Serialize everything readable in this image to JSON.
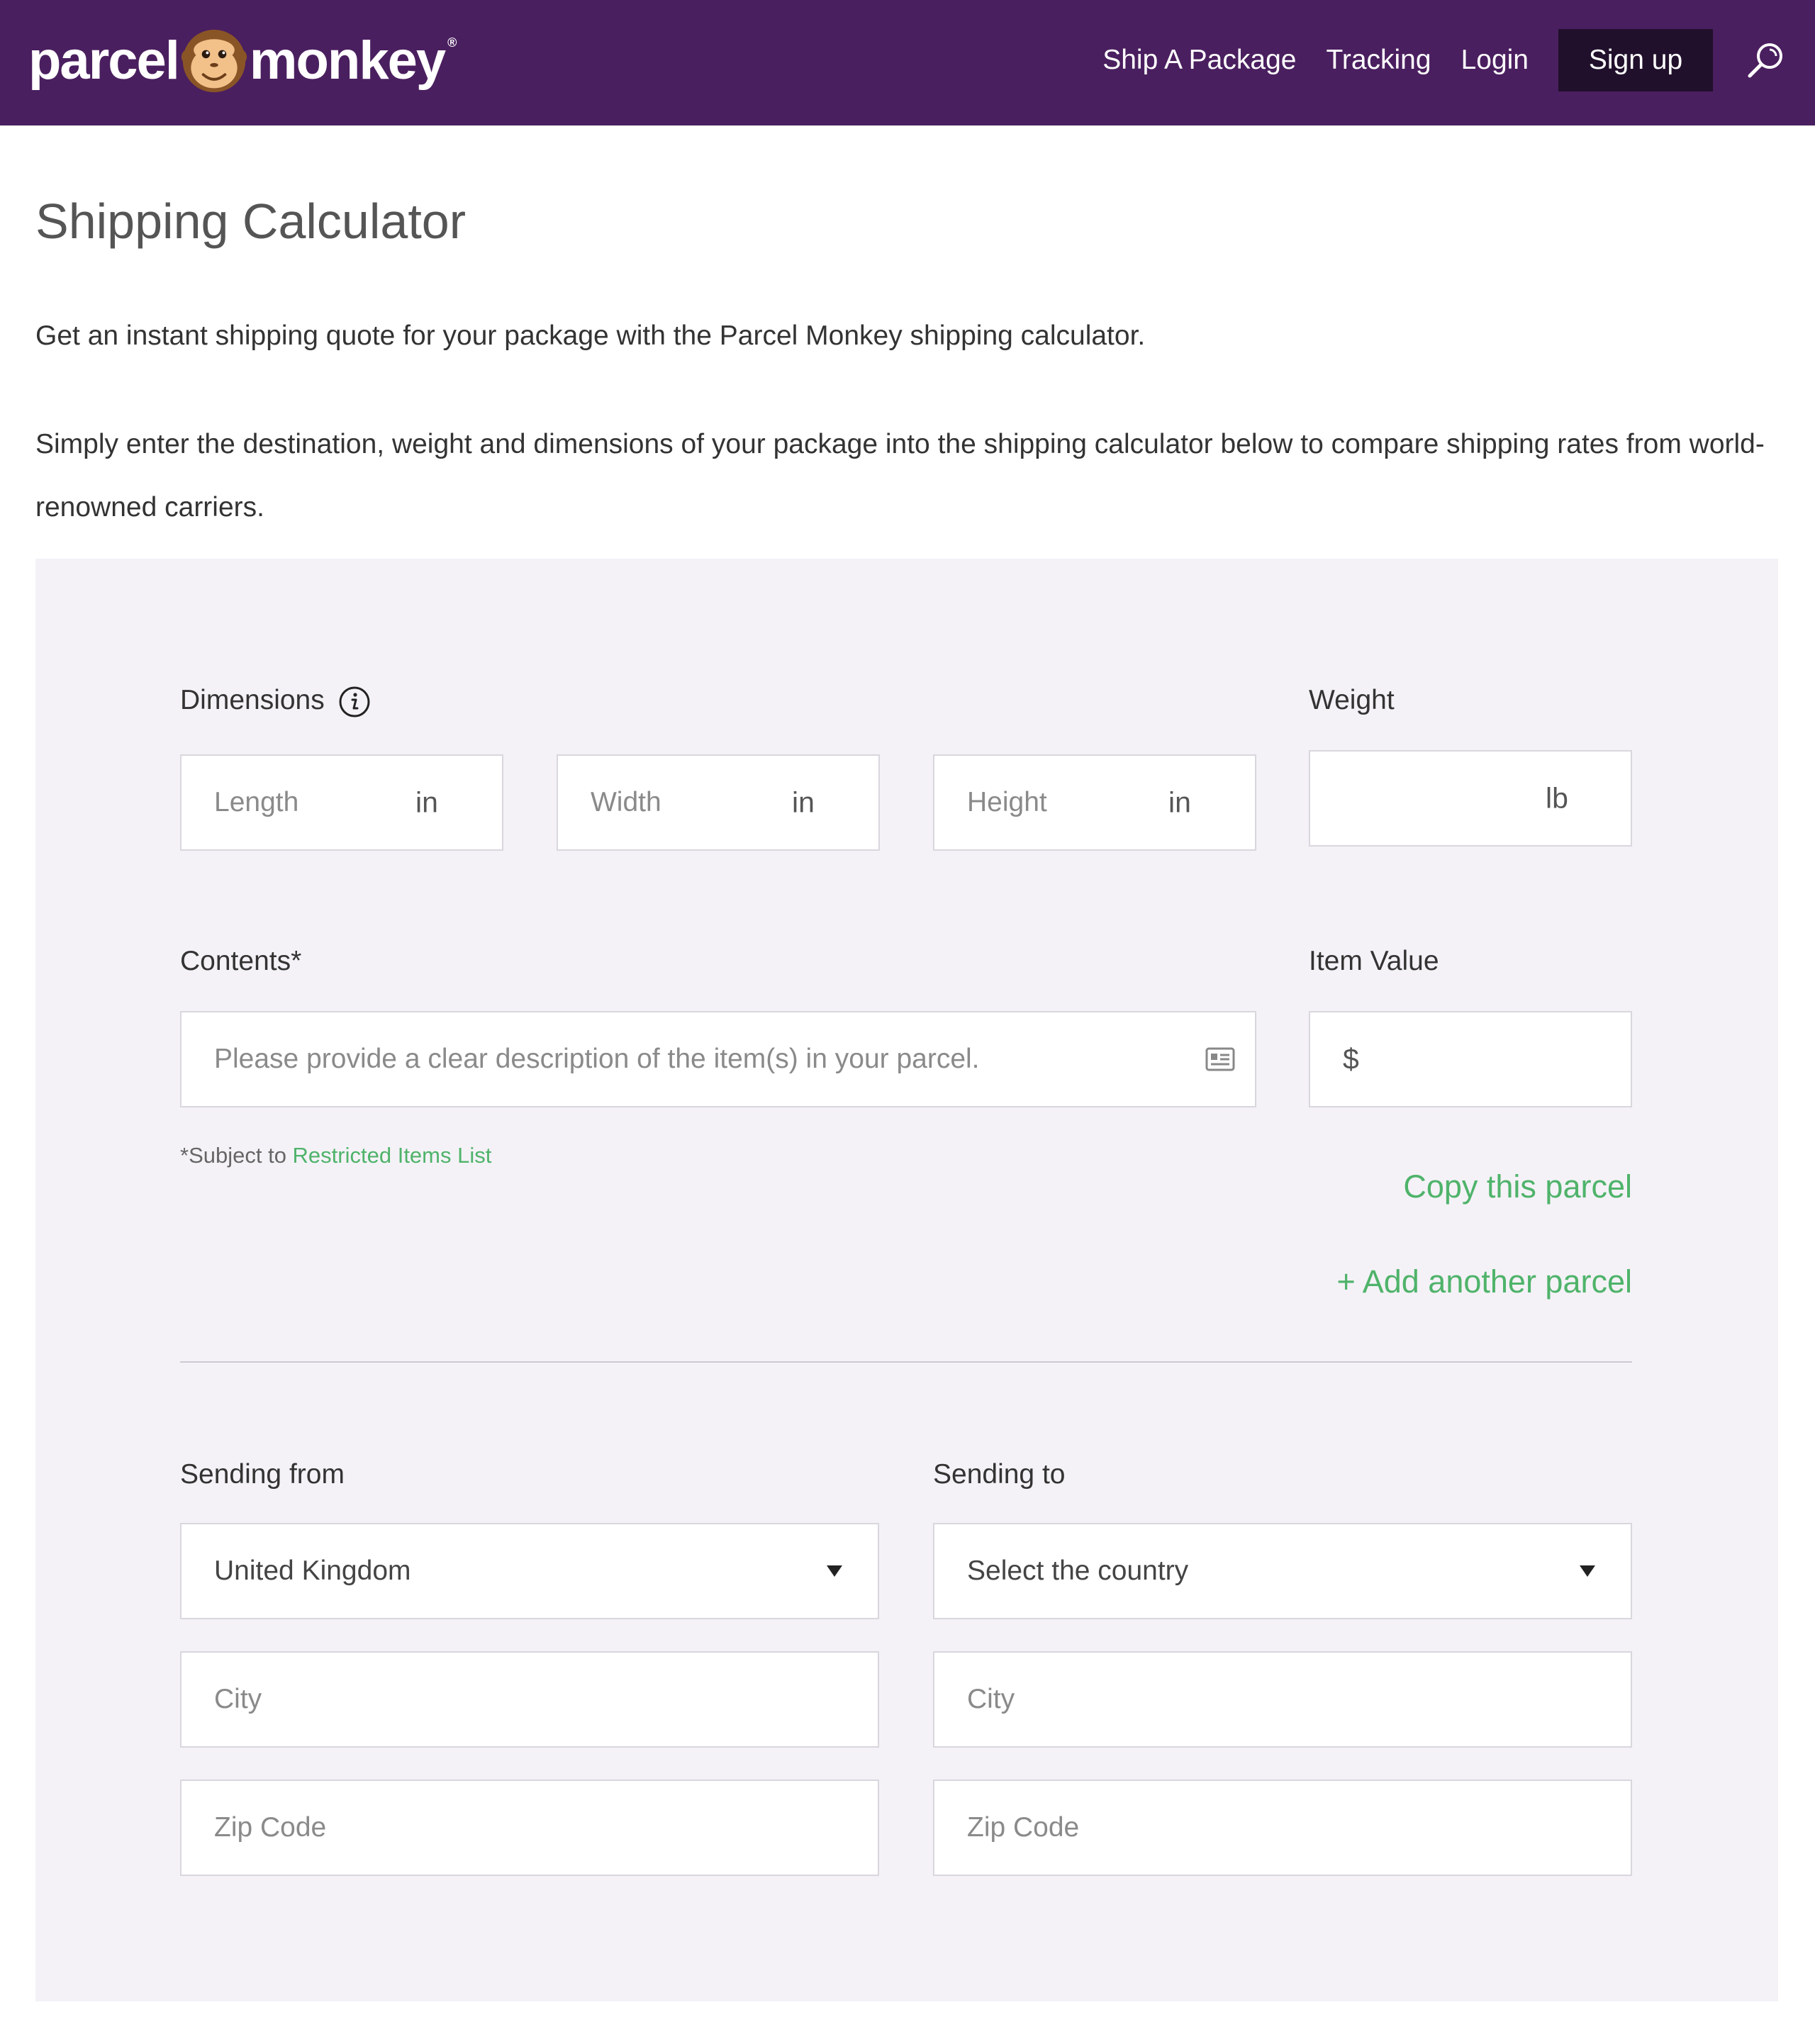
{
  "header": {
    "logo_left": "parcel",
    "logo_right": "monkey",
    "logo_reg": "®",
    "nav": [
      "Ship A Package",
      "Tracking",
      "Login"
    ],
    "signup": "Sign up",
    "colors": {
      "bg": "#4a1f5f",
      "signup_bg": "#21102c"
    }
  },
  "page": {
    "title": "Shipping Calculator",
    "intro1": "Get an instant shipping quote for your package with the Parcel Monkey shipping calculator.",
    "intro2": "Simply enter the destination, weight and dimensions of your package into the shipping calculator below to compare shipping rates from world-renowned carriers."
  },
  "form": {
    "dimensions_label": "Dimensions",
    "length_placeholder": "Length",
    "width_placeholder": "Width",
    "height_placeholder": "Height",
    "dim_unit": "in",
    "weight_label": "Weight",
    "weight_unit": "lb",
    "contents_label": "Contents*",
    "contents_placeholder": "Please provide a clear description of the item(s) in your parcel.",
    "item_value_label": "Item Value",
    "currency_symbol": "$",
    "note_prefix": "*Subject to ",
    "note_link": "Restricted Items List",
    "copy_parcel": "Copy this parcel",
    "add_parcel": "+ Add another parcel",
    "sending_from_label": "Sending from",
    "sending_from_value": "United Kingdom",
    "sending_to_label": "Sending to",
    "sending_to_value": "Select the country",
    "city_placeholder": "City",
    "zip_placeholder": "Zip Code",
    "accent_color": "#4fb36a"
  }
}
